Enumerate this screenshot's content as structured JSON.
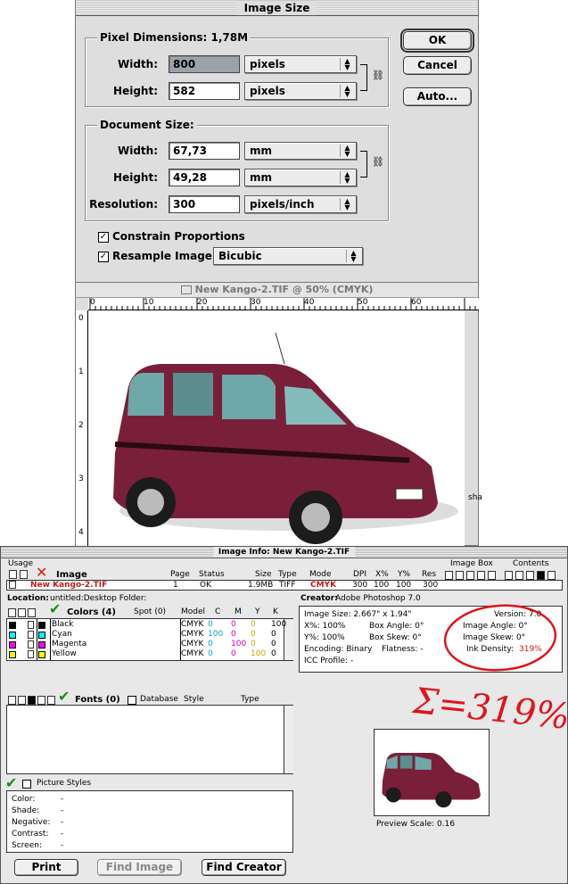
{
  "dialog": {
    "title": "Image Size",
    "pixel_dimensions": {
      "label": "Pixel Dimensions: 1,78M",
      "width_label": "Width:",
      "width_value": "800",
      "width_unit": "pixels",
      "height_label": "Height:",
      "height_value": "582",
      "height_unit": "pixels"
    },
    "document_size": {
      "label": "Document Size:",
      "width_label": "Width:",
      "width_value": "67,73",
      "width_unit": "mm",
      "height_label": "Height:",
      "height_value": "49,28",
      "height_unit": "mm",
      "resolution_label": "Resolution:",
      "resolution_value": "300",
      "resolution_unit": "pixels/inch"
    },
    "constrain_label": "Constrain Proportions",
    "resample_label": "Resample Image:",
    "resample_value": "Bicubic",
    "ok": "OK",
    "cancel": "Cancel",
    "auto": "Auto..."
  },
  "document": {
    "title": "New Kango-2.TIF @ 50% (CMYK)",
    "ruler_h": [
      "0",
      "10",
      "20",
      "30",
      "40",
      "50",
      "60"
    ],
    "ruler_v": [
      "0",
      "1",
      "2",
      "3",
      "4"
    ],
    "side_text": "sha"
  },
  "info": {
    "title": "Image Info: New Kango-2.TIF",
    "usage_label": "Usage",
    "image_box_label": "Image Box",
    "contents_label": "Contents",
    "headers": {
      "image": "Image",
      "page": "Page",
      "status": "Status",
      "size": "Size",
      "type": "Type",
      "mode": "Mode",
      "dpi": "DPI",
      "x": "X%",
      "y": "Y%",
      "res": "Res"
    },
    "row": {
      "image": "New Kango-2.TIF",
      "page": "1",
      "status": "OK",
      "size": "1.9MB",
      "type": "TIFF",
      "mode": "CMYK",
      "dpi": "300",
      "x": "100",
      "y": "100",
      "res": "300"
    },
    "location_label": "Location:",
    "location_value": "untitled:Desktop Folder:",
    "creator_label": "Creator:",
    "creator_value": "Adobe Photoshop 7.0",
    "colors_label": "Colors (4)",
    "spot_label": "Spot (0)",
    "model_label": "Model",
    "cmyk_headers": [
      "C",
      "M",
      "Y",
      "K"
    ],
    "colors": [
      {
        "name": "Black",
        "model": "CMYK",
        "c": "0",
        "m": "0",
        "y": "0",
        "k": "100",
        "swatch": "#000000"
      },
      {
        "name": "Cyan",
        "model": "CMYK",
        "c": "100",
        "m": "0",
        "y": "0",
        "k": "0",
        "swatch": "#00ffff"
      },
      {
        "name": "Magenta",
        "model": "CMYK",
        "c": "0",
        "m": "100",
        "y": "0",
        "k": "0",
        "swatch": "#ff00ff"
      },
      {
        "name": "Yellow",
        "model": "CMYK",
        "c": "0",
        "m": "0",
        "y": "100",
        "k": "0",
        "swatch": "#ffff00"
      }
    ],
    "stats": {
      "image_size": "Image Size: 2.667\" x 1.94\"",
      "version": "Version: 7.0",
      "x_pct": "X%: 100%",
      "box_angle": "Box Angle: 0°",
      "image_angle": "Image Angle: 0°",
      "y_pct": "Y%: 100%",
      "box_skew": "Box Skew: 0°",
      "image_skew": "Image Skew: 0°",
      "encoding": "Encoding: Binary",
      "flatness": "Flatness: -",
      "ink_density_label": "Ink Density:",
      "ink_density_value": "319%",
      "icc": "ICC Profile: -"
    },
    "fonts_label": "Fonts (0)",
    "database_label": "Database",
    "style_label": "Style",
    "type_label": "Type",
    "picture_styles_label": "Picture Styles",
    "styles": [
      {
        "label": "Color:",
        "value": "-"
      },
      {
        "label": "Shade:",
        "value": "-"
      },
      {
        "label": "Negative:",
        "value": "-"
      },
      {
        "label": "Contrast:",
        "value": "-"
      },
      {
        "label": "Screen:",
        "value": "-"
      }
    ],
    "preview_scale": "Preview Scale: 0.16",
    "print": "Print",
    "find_image": "Find Image",
    "find_creator": "Find Creator",
    "annotation": "Σ=319%"
  },
  "colors": {
    "annotation_red": "#e0141e",
    "car": "#7a1f3a",
    "check_green": "#1d8a1d"
  }
}
